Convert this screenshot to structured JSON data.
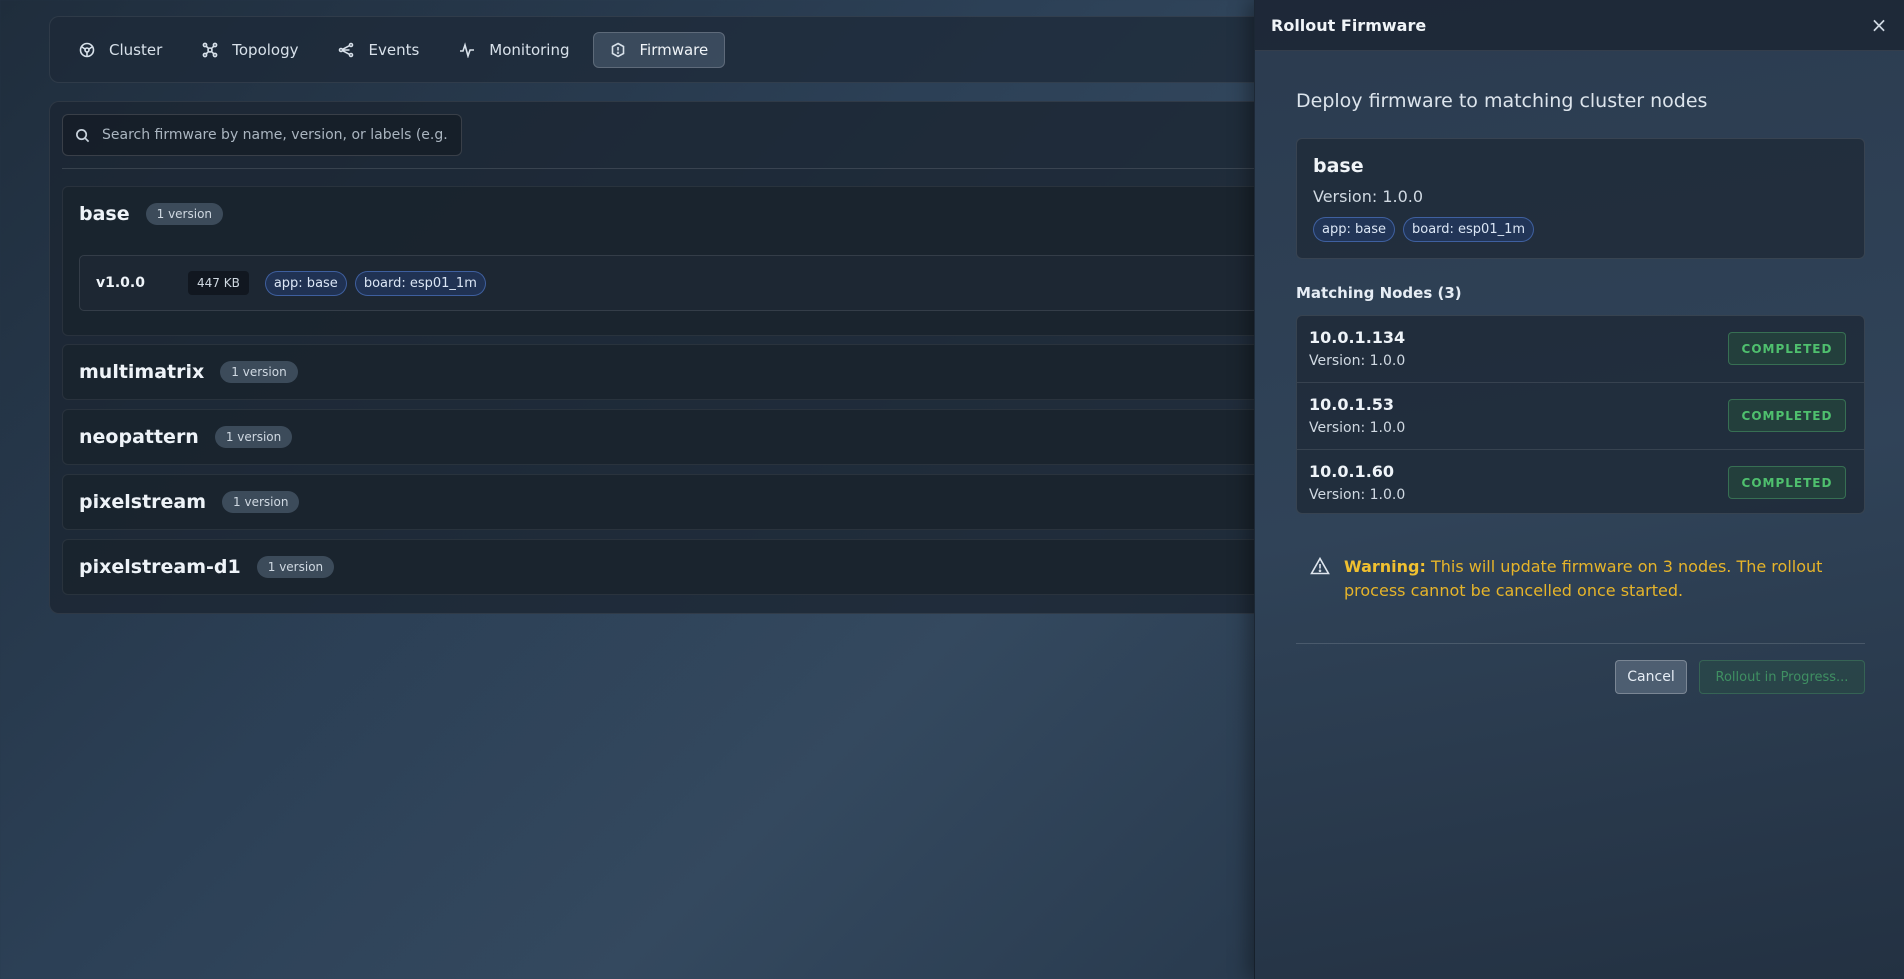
{
  "nav": {
    "items": [
      {
        "label": "Cluster",
        "icon": "cluster-icon",
        "active": false
      },
      {
        "label": "Topology",
        "icon": "topology-icon",
        "active": false
      },
      {
        "label": "Events",
        "icon": "events-icon",
        "active": false
      },
      {
        "label": "Monitoring",
        "icon": "monitoring-icon",
        "active": false
      },
      {
        "label": "Firmware",
        "icon": "firmware-icon",
        "active": true
      }
    ]
  },
  "search": {
    "placeholder": "Search firmware by name, version, or labels (e.g.",
    "value": ""
  },
  "firmware": [
    {
      "name": "base",
      "badge": "1 version",
      "expanded": true,
      "versions": [
        {
          "version": "v1.0.0",
          "size": "447 KB",
          "labels": [
            "app: base",
            "board: esp01_1m"
          ]
        }
      ]
    },
    {
      "name": "multimatrix",
      "badge": "1 version",
      "expanded": false
    },
    {
      "name": "neopattern",
      "badge": "1 version",
      "expanded": false
    },
    {
      "name": "pixelstream",
      "badge": "1 version",
      "expanded": false
    },
    {
      "name": "pixelstream-d1",
      "badge": "1 version",
      "expanded": false
    }
  ],
  "drawer": {
    "title": "Rollout Firmware",
    "close": "×",
    "subtitle": "Deploy firmware to matching cluster nodes",
    "summary": {
      "name": "base",
      "version": "Version: 1.0.0",
      "labels": [
        "app: base",
        "board: esp01_1m"
      ]
    },
    "matching_title": "Matching Nodes (3)",
    "nodes": [
      {
        "ip": "10.0.1.134",
        "version": "Version: 1.0.0",
        "status": "COMPLETED"
      },
      {
        "ip": "10.0.1.53",
        "version": "Version: 1.0.0",
        "status": "COMPLETED"
      },
      {
        "ip": "10.0.1.60",
        "version": "Version: 1.0.0",
        "status": "COMPLETED"
      }
    ],
    "warning": {
      "strong": "Warning:",
      "text": " This will update firmware on 3 nodes. The rollout process cannot be cancelled once started."
    },
    "cancel_label": "Cancel",
    "rollout_label": "Rollout in Progress..."
  },
  "colors": {
    "accent_warning": "#e6b42a",
    "status_completed": "#4fc06e",
    "label_border": "#5078c8"
  }
}
